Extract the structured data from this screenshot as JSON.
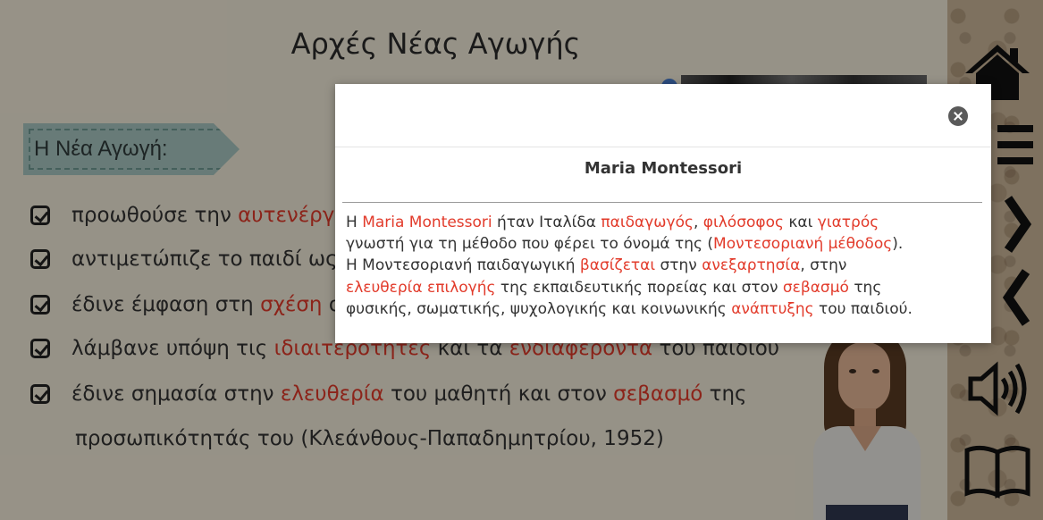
{
  "slide": {
    "title": "Αρχές Νέας Αγωγής",
    "tag_label": "Η Νέα Αγωγή:",
    "bullets": [
      {
        "pre": "προωθούσε την ",
        "red": "αυτενέργ",
        "post": ""
      },
      {
        "pre": "αντιμετώπιζε το παιδί ως",
        "red": "",
        "post": ""
      },
      {
        "pre": "έδινε έμφαση στη ",
        "red": "σχέση",
        "post": " σ"
      },
      {
        "pre": "λάμβανε υπόψη τις ",
        "red": "ιδιαιτερότητες",
        "post": " και τα ",
        "red2": "ενδιαφέροντα",
        "post2": " του παιδιού"
      },
      {
        "pre": "έδινε σημασία στην ",
        "red": "ελευθερία",
        "post": " του μαθητή και στον ",
        "red2": "σεβασμό",
        "post2": " της"
      }
    ],
    "bullet_continuation": "προσωπικότητάς του (Κλεάνθους-Παπαδημητρίου, 1952)"
  },
  "sidebar": {
    "icons": [
      "home-icon",
      "menu-icon",
      "next-arrow-icon",
      "back-arrow-icon",
      "speaker-icon",
      "book-icon"
    ]
  },
  "modal": {
    "title": "Maria Montessori",
    "body": {
      "l1_a": "Η ",
      "l1_b": "Maria Montessori",
      "l1_c": " ήταν Ιταλίδα ",
      "l1_d": "παιδαγωγός",
      "l1_e": ", ",
      "l1_f": "φιλόσοφος",
      "l1_g": " και ",
      "l1_h": "γιατρός",
      "l2_a": "γνωστή για τη μέθοδο που φέρει το όνομά της (",
      "l2_b": "Μοντεσοριανή μέθοδος",
      "l2_c": ").",
      "l3_a": "Η Μοντεσοριανή παιδαγωγική ",
      "l3_b": "βασίζεται",
      "l3_c": " στην ",
      "l3_d": "ανεξαρτησία",
      "l3_e": ", στην",
      "l4_a": "ελευθερία επιλογής",
      "l4_b": " της εκπαιδευτικής πορείας και στον ",
      "l4_c": "σεβασμό",
      "l4_d": " της",
      "l5_a": "φυσικής, σωματικής, ψυχολογικής και κοινωνικής ",
      "l5_b": "ανάπτυξης",
      "l5_c": " του παιδιού."
    }
  },
  "colors": {
    "accent_red": "#e23b2b",
    "tag_bg": "#a9c7c2"
  }
}
